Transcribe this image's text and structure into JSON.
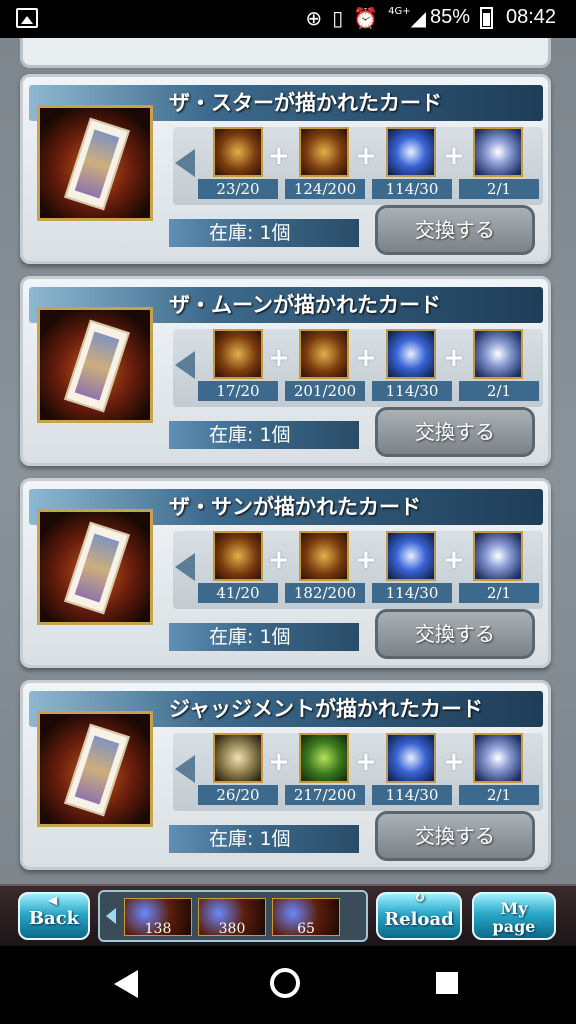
{
  "status_bar": {
    "icons": [
      "image-icon",
      "data-saver-icon",
      "vibrate-icon",
      "alarm-icon",
      "signal-4g-icon"
    ],
    "network": "4G+",
    "battery": "85%",
    "time": "08:42"
  },
  "cards": [
    {
      "title": "ザ・スターが描かれたカード",
      "materials": [
        {
          "icon": "star-medal-icon",
          "count": "23/20"
        },
        {
          "icon": "gold-sigil-icon",
          "count": "124/200"
        },
        {
          "icon": "blue-crystal-icon",
          "count": "114/30"
        },
        {
          "icon": "blue-gem-icon",
          "count": "2/1"
        }
      ],
      "stock": "在庫: 1個",
      "exchange_label": "交換する"
    },
    {
      "title": "ザ・ムーンが描かれたカード",
      "materials": [
        {
          "icon": "moon-medal-icon",
          "count": "17/20"
        },
        {
          "icon": "gold-sigil-icon",
          "count": "201/200"
        },
        {
          "icon": "blue-crystal-icon",
          "count": "114/30"
        },
        {
          "icon": "blue-gem-icon",
          "count": "2/1"
        }
      ],
      "stock": "在庫: 1個",
      "exchange_label": "交換する"
    },
    {
      "title": "ザ・サンが描かれたカード",
      "materials": [
        {
          "icon": "sun-medal-icon",
          "count": "41/20"
        },
        {
          "icon": "red-sigil-icon",
          "count": "182/200"
        },
        {
          "icon": "blue-crystal-icon",
          "count": "114/30"
        },
        {
          "icon": "blue-gem-icon",
          "count": "2/1"
        }
      ],
      "stock": "在庫: 1個",
      "exchange_label": "交換する"
    },
    {
      "title": "ジャッジメントが描かれたカード",
      "materials": [
        {
          "icon": "judgment-medal-icon",
          "count": "26/20"
        },
        {
          "icon": "green-sigil-icon",
          "count": "217/200"
        },
        {
          "icon": "blue-crystal-icon",
          "count": "114/30"
        },
        {
          "icon": "blue-gem-icon",
          "count": "2/1"
        }
      ],
      "stock": "在庫: 1個",
      "exchange_label": "交換する"
    }
  ],
  "bottom_bar": {
    "back_label": "Back",
    "reload_label": "Reload",
    "mypage_line1": "My",
    "mypage_line2": "page",
    "resources": [
      "138",
      "380",
      "65"
    ]
  }
}
